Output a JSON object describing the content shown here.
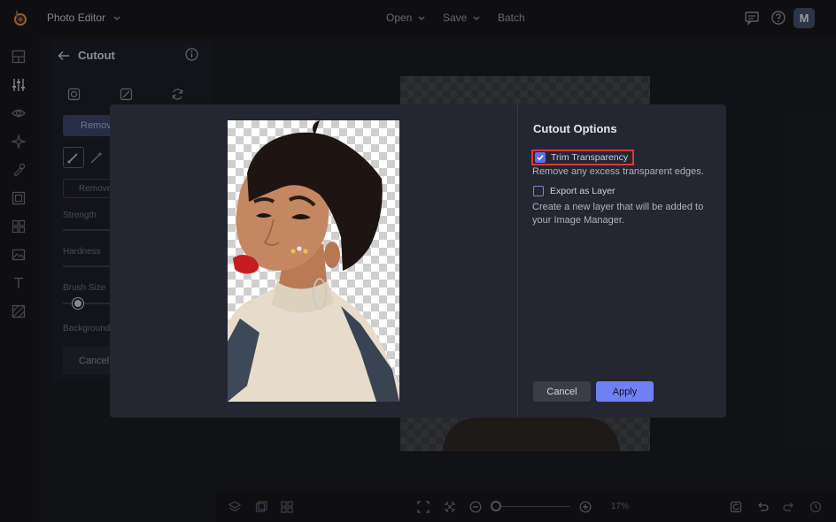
{
  "header": {
    "app_title": "Photo Editor",
    "menu": {
      "open": "Open",
      "save": "Save",
      "batch": "Batch"
    },
    "avatar_initial": "M"
  },
  "side_panel": {
    "title": "Cutout",
    "remove_label": "Remove",
    "remove_bg_label": "Remove",
    "strength_label": "Strength",
    "hardness_label": "Hardness",
    "brush_size_label": "Brush Size",
    "background_label": "Background",
    "cancel_label": "Cancel"
  },
  "bottom_bar": {
    "zoom": "17%"
  },
  "modal": {
    "title": "Cutout Options",
    "trim": {
      "label": "Trim Transparency",
      "checked": true,
      "description": "Remove any excess transparent edges."
    },
    "export": {
      "label": "Export as Layer",
      "checked": false,
      "description": "Create a new layer that will be added to your Image Manager."
    },
    "cancel_label": "Cancel",
    "apply_label": "Apply"
  },
  "colors": {
    "accent": "#6f80f4",
    "highlight_border": "#d83a34",
    "modal_bg": "#242731",
    "app_bg": "#1b1d23"
  }
}
